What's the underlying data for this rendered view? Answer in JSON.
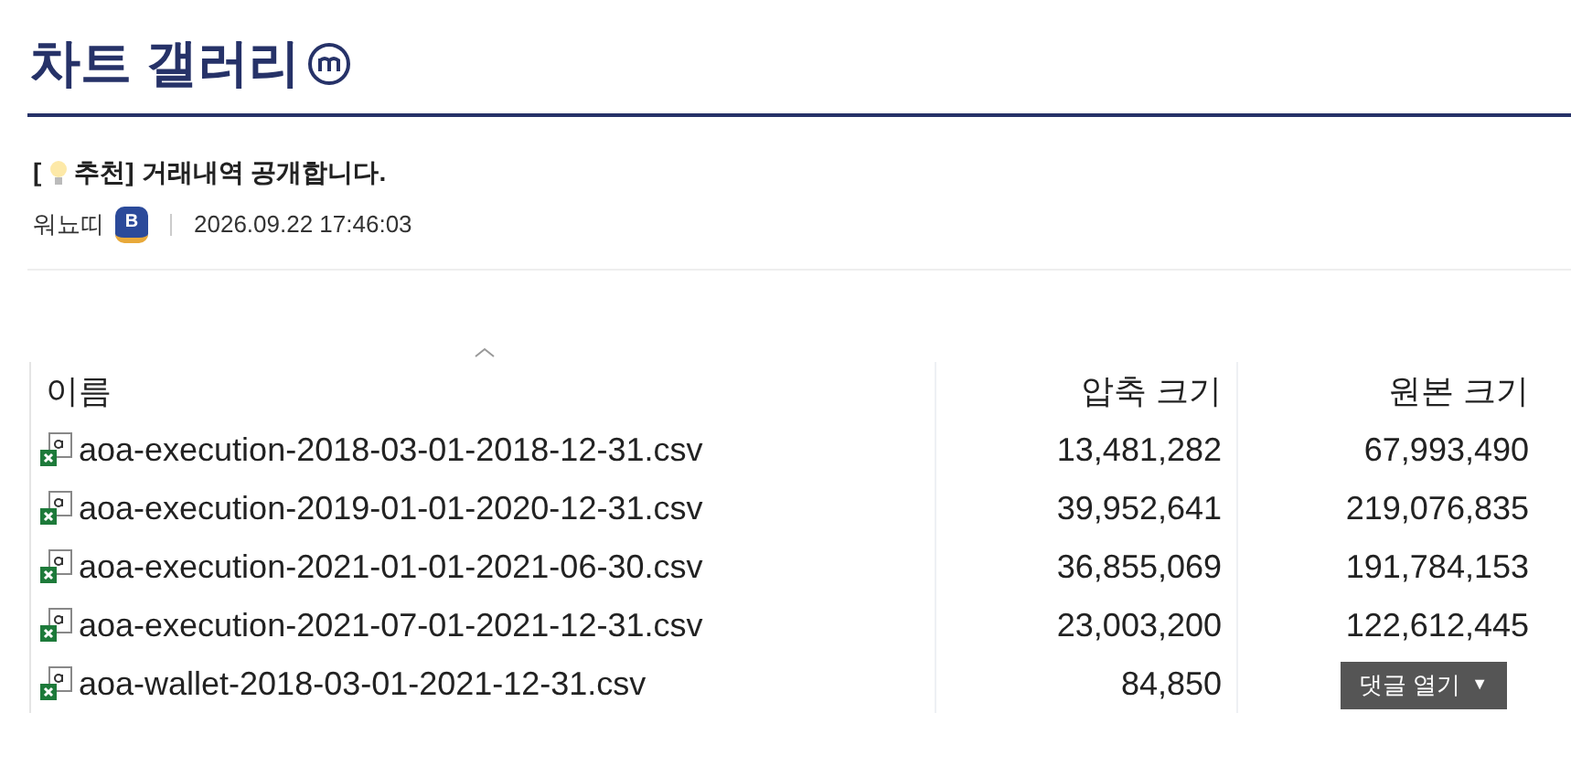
{
  "page_title": "차트 갤러리",
  "post": {
    "tag_open": "[",
    "tag_close": "추천]",
    "title": "거래내역 공개합니다.",
    "author": "워뇨띠",
    "badge": "B",
    "timestamp": "2026.09.22 17:46:03"
  },
  "table": {
    "columns": [
      "이름",
      "압축 크기",
      "원본 크기"
    ],
    "rows": [
      {
        "name": "aoa-execution-2018-03-01-2018-12-31.csv",
        "compressed": "13,481,282",
        "original": "67,993,490"
      },
      {
        "name": "aoa-execution-2019-01-01-2020-12-31.csv",
        "compressed": "39,952,641",
        "original": "219,076,835"
      },
      {
        "name": "aoa-execution-2021-01-01-2021-06-30.csv",
        "compressed": "36,855,069",
        "original": "191,784,153"
      },
      {
        "name": "aoa-execution-2021-07-01-2021-12-31.csv",
        "compressed": "23,003,200",
        "original": "122,612,445"
      },
      {
        "name": "aoa-wallet-2018-03-01-2021-12-31.csv",
        "compressed": "84,850"
      }
    ]
  },
  "comment_button": {
    "label": "댓글 열기",
    "caret": "▼"
  }
}
